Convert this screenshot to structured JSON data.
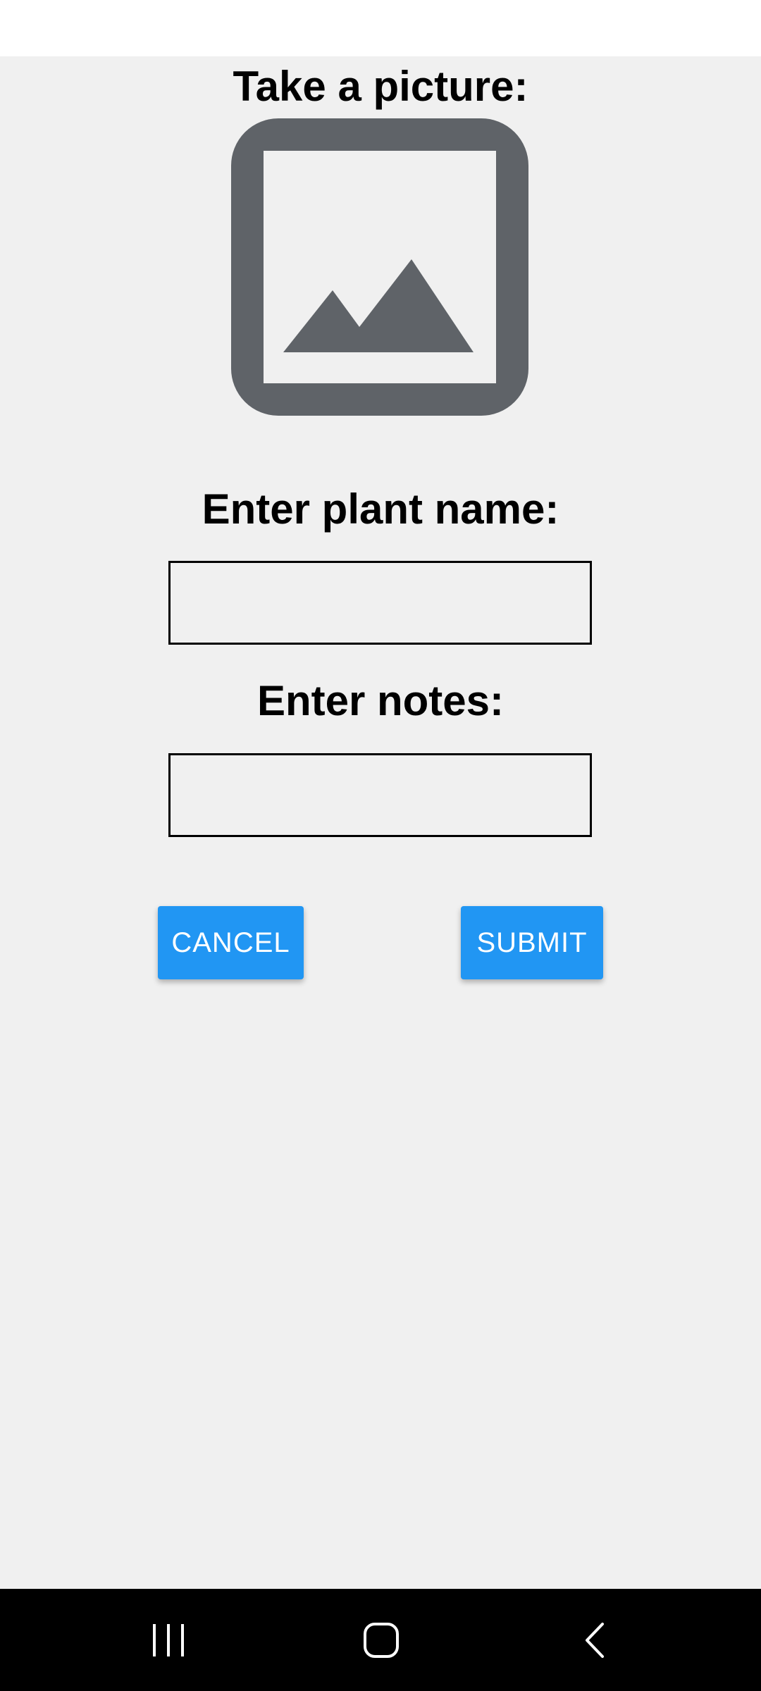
{
  "form": {
    "picture_label": "Take a picture:",
    "picture_icon": "image-placeholder-icon",
    "plant_name_label": "Enter plant name:",
    "plant_name_value": "",
    "notes_label": "Enter notes:",
    "notes_value": ""
  },
  "buttons": {
    "cancel_label": "CANCEL",
    "submit_label": "SUBMIT"
  },
  "navigation": {
    "recent_icon": "recent-apps-icon",
    "home_icon": "home-icon",
    "back_icon": "back-icon"
  },
  "colors": {
    "background": "#f0f0f0",
    "button": "#2196f3",
    "button_text": "#ffffff",
    "icon": "#5f6368",
    "nav_bar": "#000000"
  }
}
